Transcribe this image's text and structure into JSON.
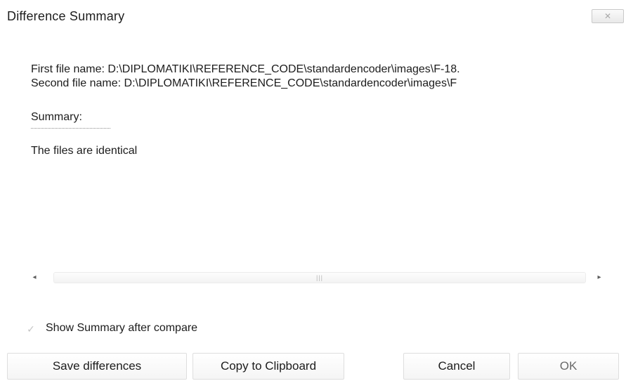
{
  "window": {
    "title": "Difference Summary",
    "close_glyph": "✕"
  },
  "files": {
    "first_line": "First file name: D:\\DIPLOMATIKI\\REFERENCE_CODE\\standardencoder\\images\\F-18.",
    "second_line": "Second file name: D:\\DIPLOMATIKI\\REFERENCE_CODE\\standardencoder\\images\\F"
  },
  "summary": {
    "label": "Summary:",
    "text": "The files are identical"
  },
  "scrollbar": {
    "left_arrow": "◂",
    "right_arrow": "▸",
    "grip": "|||"
  },
  "options": {
    "show_summary_label": "Show Summary after compare",
    "show_summary_checked": true,
    "check_glyph": "✓"
  },
  "buttons": {
    "save_differences": "Save differences",
    "copy_to_clipboard": "Copy to Clipboard",
    "cancel": "Cancel",
    "ok": "OK"
  },
  "icons": {
    "close": "close-icon",
    "checkbox": "checkmark-icon",
    "scroll_left": "scroll-left-arrow-icon",
    "scroll_right": "scroll-right-arrow-icon"
  }
}
